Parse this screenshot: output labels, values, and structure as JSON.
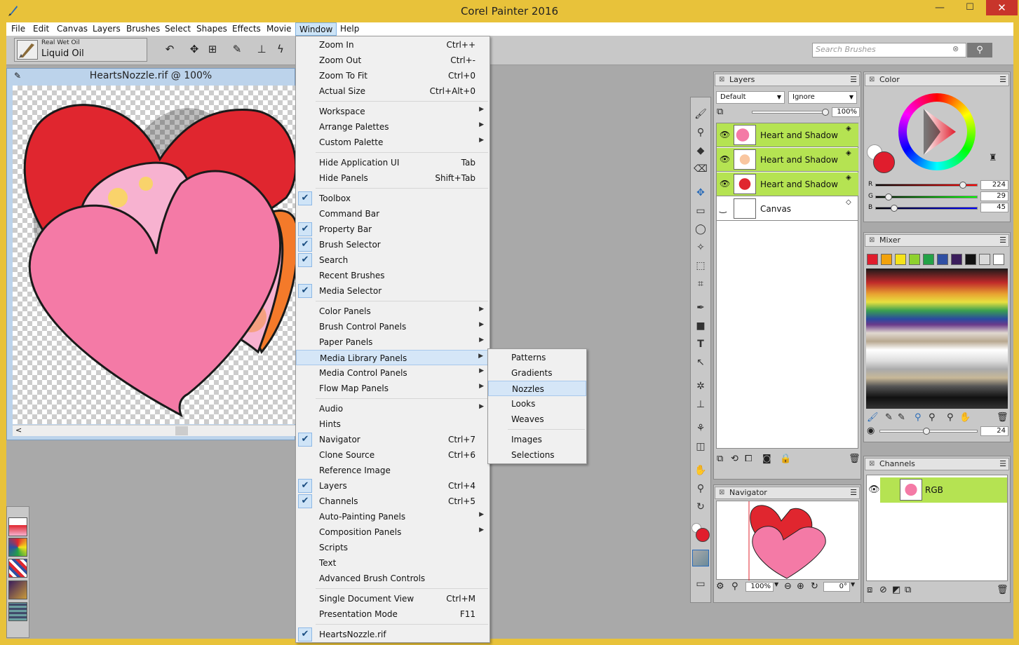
{
  "app": {
    "title": "Corel Painter 2016"
  },
  "window_controls": {
    "minimize": "—",
    "maximize": "☐",
    "close": "✕"
  },
  "menubar": [
    "File",
    "Edit",
    "Canvas",
    "Layers",
    "Brushes",
    "Select",
    "Shapes",
    "Effects",
    "Movie",
    "Window",
    "Help"
  ],
  "brush": {
    "category": "Real Wet Oil",
    "variant": "Liquid Oil"
  },
  "search": {
    "placeholder": "Search Brushes"
  },
  "document": {
    "title": "HeartsNozzle.rif @ 100%"
  },
  "window_menu": {
    "items": [
      {
        "label": "Zoom In",
        "shortcut": "Ctrl++"
      },
      {
        "label": "Zoom Out",
        "shortcut": "Ctrl+-"
      },
      {
        "label": "Zoom To Fit",
        "shortcut": "Ctrl+0"
      },
      {
        "label": "Actual Size",
        "shortcut": "Ctrl+Alt+0"
      },
      {
        "label": "Workspace",
        "submenu": true
      },
      {
        "label": "Arrange Palettes",
        "submenu": true
      },
      {
        "label": "Custom Palette",
        "submenu": true
      },
      {
        "label": "Hide Application UI",
        "shortcut": "Tab"
      },
      {
        "label": "Hide Panels",
        "shortcut": "Shift+Tab"
      },
      {
        "label": "Toolbox",
        "checked": true
      },
      {
        "label": "Command Bar"
      },
      {
        "label": "Property Bar",
        "checked": true
      },
      {
        "label": "Brush Selector",
        "checked": true
      },
      {
        "label": "Search",
        "checked": true
      },
      {
        "label": "Recent Brushes"
      },
      {
        "label": "Media Selector",
        "checked": true
      },
      {
        "label": "Color Panels",
        "submenu": true
      },
      {
        "label": "Brush Control Panels",
        "submenu": true
      },
      {
        "label": "Paper Panels",
        "submenu": true
      },
      {
        "label": "Media Library Panels",
        "submenu": true,
        "highlighted": true
      },
      {
        "label": "Media Control Panels",
        "submenu": true
      },
      {
        "label": "Flow Map Panels",
        "submenu": true
      },
      {
        "label": "Audio",
        "submenu": true
      },
      {
        "label": "Hints"
      },
      {
        "label": "Navigator",
        "shortcut": "Ctrl+7",
        "checked": true
      },
      {
        "label": "Clone Source",
        "shortcut": "Ctrl+6"
      },
      {
        "label": "Reference Image"
      },
      {
        "label": "Layers",
        "shortcut": "Ctrl+4",
        "checked": true
      },
      {
        "label": "Channels",
        "shortcut": "Ctrl+5",
        "checked": true
      },
      {
        "label": "Auto-Painting Panels",
        "submenu": true
      },
      {
        "label": "Composition Panels",
        "submenu": true
      },
      {
        "label": "Scripts"
      },
      {
        "label": "Text"
      },
      {
        "label": "Advanced Brush Controls"
      },
      {
        "label": "Single Document View",
        "shortcut": "Ctrl+M"
      },
      {
        "label": "Presentation Mode",
        "shortcut": "F11"
      },
      {
        "label": "HeartsNozzle.rif",
        "checked": true
      }
    ]
  },
  "submenu": {
    "items": [
      "Patterns",
      "Gradients",
      "Nozzles",
      "Looks",
      "Weaves",
      "Images",
      "Selections"
    ],
    "highlighted": "Nozzles"
  },
  "layers_panel": {
    "title": "Layers",
    "composite_method": "Default",
    "preserve": "Ignore",
    "opacity": "100%",
    "layers": [
      {
        "name": "Heart and Shadow",
        "selected": true
      },
      {
        "name": "Heart and Shadow",
        "selected": true
      },
      {
        "name": "Heart and Shadow",
        "selected": true
      },
      {
        "name": "Canvas",
        "selected": false
      }
    ]
  },
  "color_panel": {
    "title": "Color",
    "r": "224",
    "g": "29",
    "b": "45",
    "r_label": "R",
    "g_label": "G",
    "b_label": "B",
    "main_color": "#e01d2d"
  },
  "mixer_panel": {
    "title": "Mixer",
    "swatches": [
      "#e01d2d",
      "#f2a20c",
      "#f5e31a",
      "#8ed12f",
      "#23a247",
      "#2f4fa3",
      "#3b1d5c",
      "#111111",
      "#d9d9d9",
      "#ffffff"
    ],
    "brush_size": "24"
  },
  "navigator_panel": {
    "title": "Navigator",
    "zoom": "100%",
    "rotation": "0°"
  },
  "channels_panel": {
    "title": "Channels",
    "channel": "RGB"
  }
}
